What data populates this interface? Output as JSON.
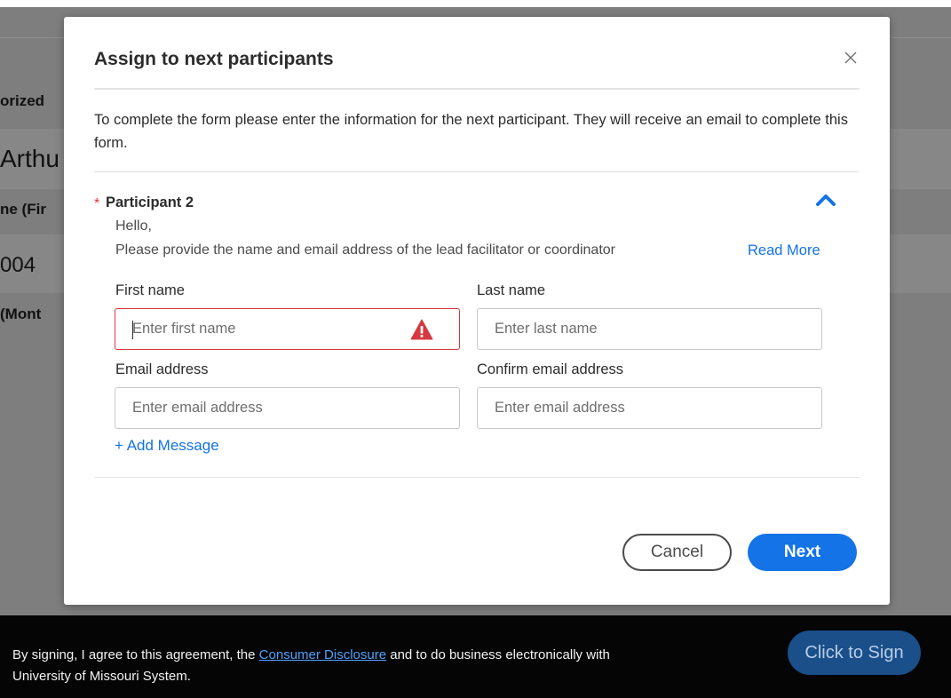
{
  "background": {
    "fragments": [
      "orized",
      "Arthu",
      "ne (Fir",
      "004",
      "(Mont"
    ]
  },
  "modal": {
    "title": "Assign to next participants",
    "intro": "To complete the form please enter the information for the next participant. They will receive an email to complete this form.",
    "participant": {
      "required_marker": "*",
      "label": "Participant 2",
      "greeting": "Hello,",
      "description": "Please provide the name and email address of the lead facilitator or coordinator",
      "read_more": "Read More"
    },
    "fields": {
      "first_name": {
        "label": "First name",
        "placeholder": "Enter first name",
        "state": "error"
      },
      "last_name": {
        "label": "Last name",
        "placeholder": "Enter last name"
      },
      "email": {
        "label": "Email address",
        "placeholder": "Enter email address"
      },
      "confirm_email": {
        "label": "Confirm email address",
        "placeholder": "Enter email address"
      }
    },
    "add_message": "+ Add Message",
    "buttons": {
      "cancel": "Cancel",
      "next": "Next"
    }
  },
  "footer": {
    "text_before": "By signing, I agree to this agreement, the ",
    "link": "Consumer Disclosure",
    "text_after": " and to do business electronically with University of Missouri System.",
    "sign_button": "Click to Sign"
  },
  "colors": {
    "accent": "#1473e6",
    "error": "#d7373f",
    "overlay": "#7e7e7e",
    "footer": "#050505"
  }
}
